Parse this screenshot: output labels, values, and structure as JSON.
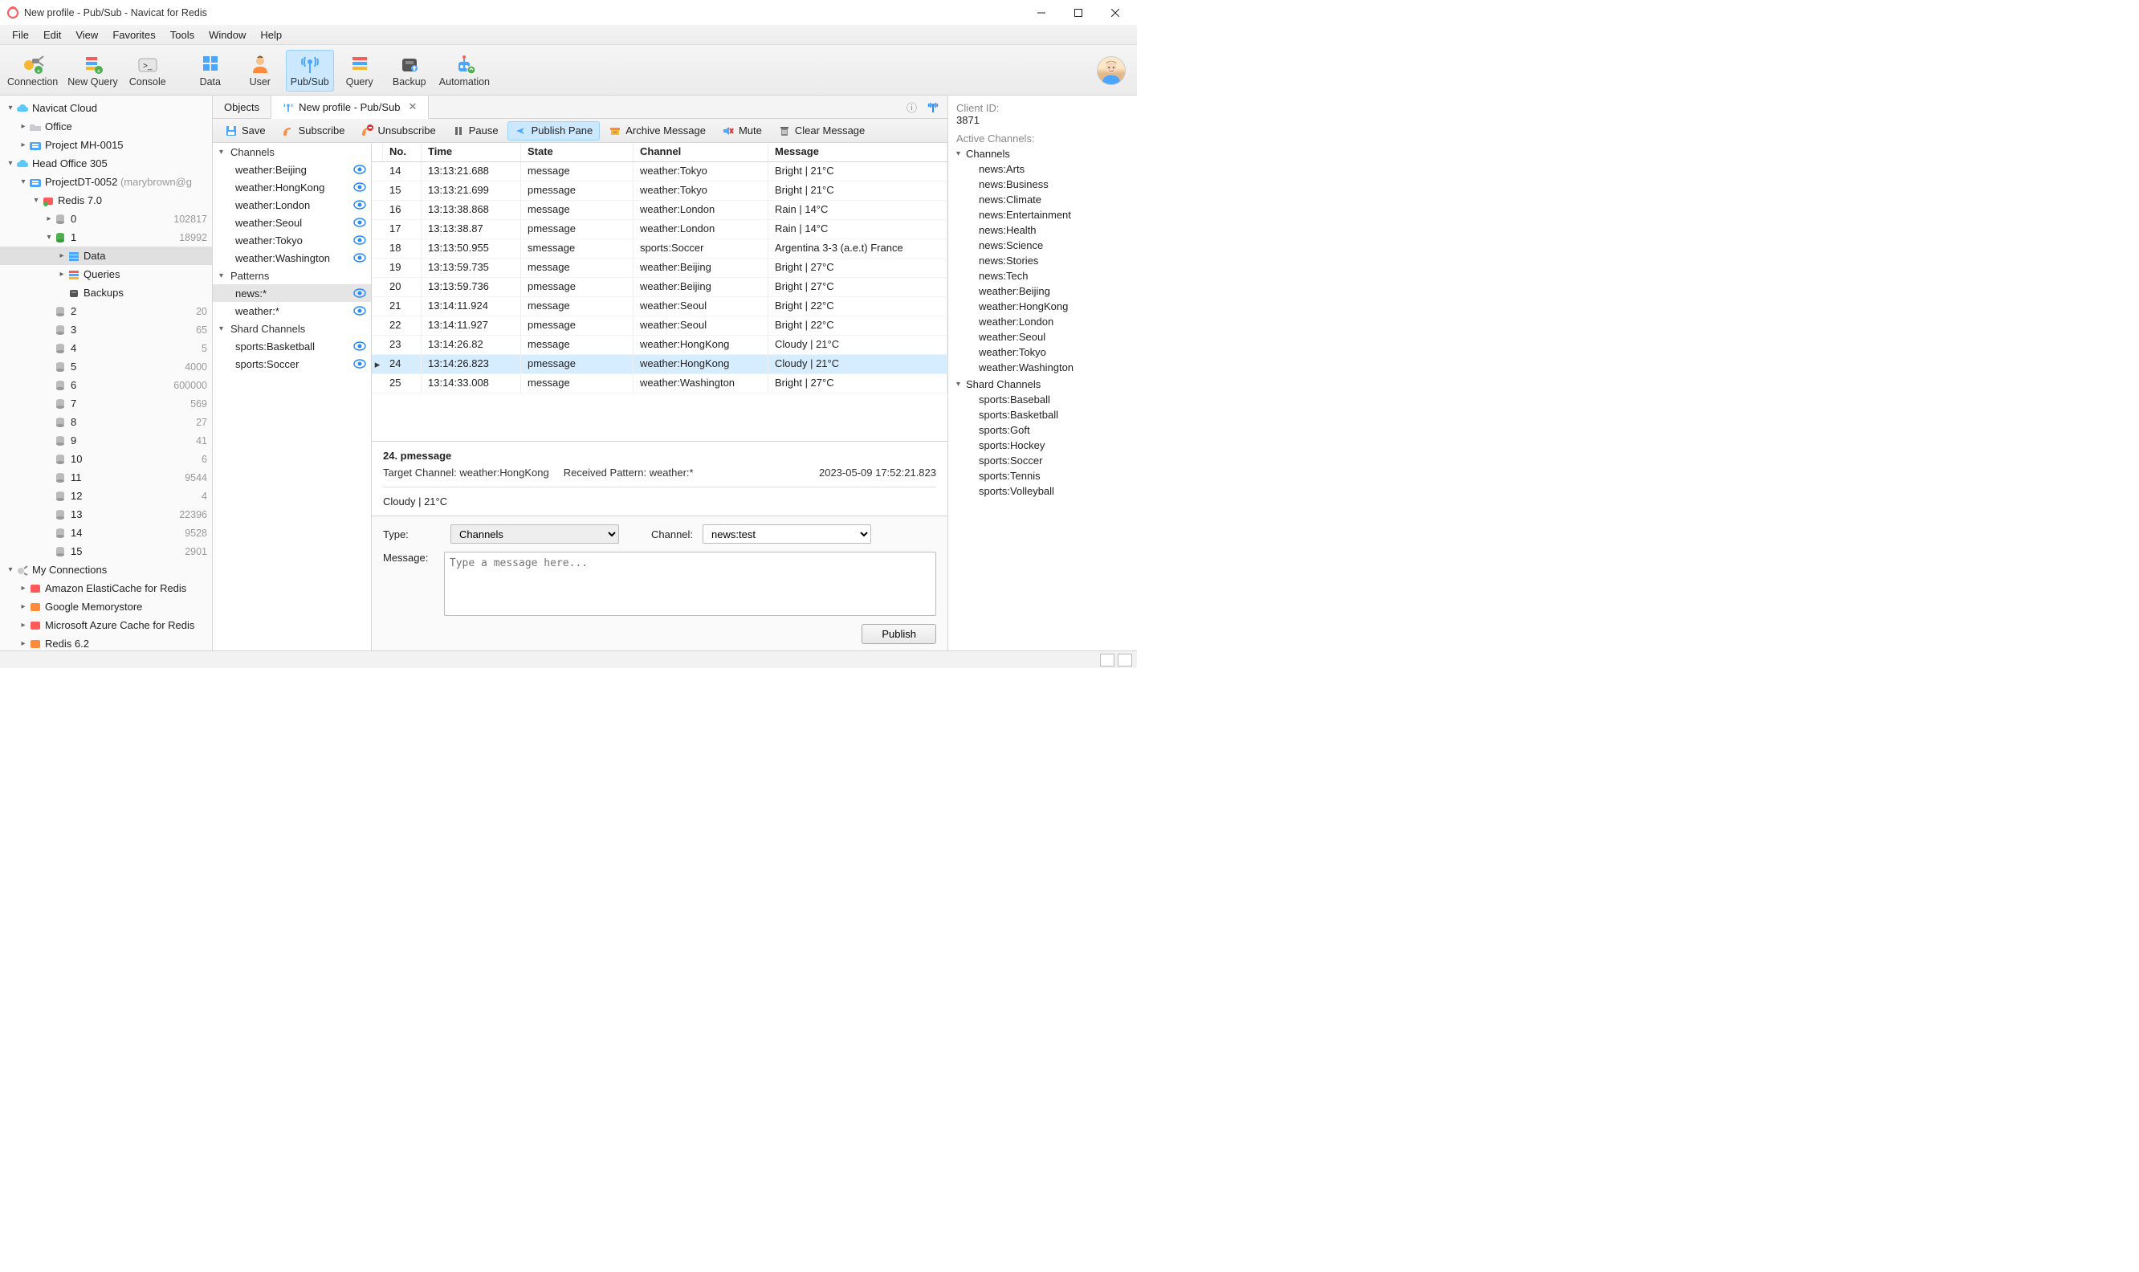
{
  "window": {
    "title": "New profile - Pub/Sub - Navicat for Redis"
  },
  "menu": [
    "File",
    "Edit",
    "View",
    "Favorites",
    "Tools",
    "Window",
    "Help"
  ],
  "toolbar": [
    {
      "icon": "plug",
      "label": "Connection"
    },
    {
      "icon": "file-new",
      "label": "New Query"
    },
    {
      "icon": "console",
      "label": "Console"
    },
    {
      "spacer": true
    },
    {
      "icon": "data",
      "label": "Data"
    },
    {
      "icon": "user",
      "label": "User"
    },
    {
      "icon": "pubsub",
      "label": "Pub/Sub",
      "active": true
    },
    {
      "icon": "query",
      "label": "Query"
    },
    {
      "icon": "backup",
      "label": "Backup"
    },
    {
      "icon": "automation",
      "label": "Automation"
    }
  ],
  "left_tree": [
    {
      "depth": 0,
      "twisty": "down",
      "icon": "cloud",
      "label": "Navicat Cloud"
    },
    {
      "depth": 1,
      "twisty": "right",
      "icon": "folder",
      "label": "Office"
    },
    {
      "depth": 1,
      "twisty": "right",
      "icon": "folder-b",
      "label": "Project MH-0015"
    },
    {
      "depth": 0,
      "twisty": "down",
      "icon": "cloud",
      "label": "Head Office 305"
    },
    {
      "depth": 1,
      "twisty": "down",
      "icon": "folder-b",
      "label": "ProjectDT-0052",
      "trailing_dim": "(marybrown@g"
    },
    {
      "depth": 2,
      "twisty": "down",
      "icon": "redis",
      "label": "Redis 7.0"
    },
    {
      "depth": 3,
      "twisty": "right",
      "icon": "db",
      "label": "0",
      "count": "102817"
    },
    {
      "depth": 3,
      "twisty": "down",
      "icon": "db-green",
      "label": "1",
      "count": "18992"
    },
    {
      "depth": 4,
      "twisty": "right",
      "icon": "rows",
      "label": "Data",
      "selected": true
    },
    {
      "depth": 4,
      "twisty": "right",
      "icon": "query",
      "label": "Queries"
    },
    {
      "depth": 4,
      "twisty": "",
      "icon": "backup",
      "label": "Backups"
    },
    {
      "depth": 3,
      "twisty": "",
      "icon": "db",
      "label": "2",
      "count": "20"
    },
    {
      "depth": 3,
      "twisty": "",
      "icon": "db",
      "label": "3",
      "count": "65"
    },
    {
      "depth": 3,
      "twisty": "",
      "icon": "db",
      "label": "4",
      "count": "5"
    },
    {
      "depth": 3,
      "twisty": "",
      "icon": "db",
      "label": "5",
      "count": "4000"
    },
    {
      "depth": 3,
      "twisty": "",
      "icon": "db",
      "label": "6",
      "count": "600000"
    },
    {
      "depth": 3,
      "twisty": "",
      "icon": "db",
      "label": "7",
      "count": "569"
    },
    {
      "depth": 3,
      "twisty": "",
      "icon": "db",
      "label": "8",
      "count": "27"
    },
    {
      "depth": 3,
      "twisty": "",
      "icon": "db",
      "label": "9",
      "count": "41"
    },
    {
      "depth": 3,
      "twisty": "",
      "icon": "db",
      "label": "10",
      "count": "6"
    },
    {
      "depth": 3,
      "twisty": "",
      "icon": "db",
      "label": "11",
      "count": "9544"
    },
    {
      "depth": 3,
      "twisty": "",
      "icon": "db",
      "label": "12",
      "count": "4"
    },
    {
      "depth": 3,
      "twisty": "",
      "icon": "db",
      "label": "13",
      "count": "22396"
    },
    {
      "depth": 3,
      "twisty": "",
      "icon": "db",
      "label": "14",
      "count": "9528"
    },
    {
      "depth": 3,
      "twisty": "",
      "icon": "db",
      "label": "15",
      "count": "2901"
    },
    {
      "depth": 0,
      "twisty": "down",
      "icon": "plug",
      "label": "My Connections"
    },
    {
      "depth": 1,
      "twisty": "right",
      "icon": "svc-r",
      "label": "Amazon ElastiCache for Redis"
    },
    {
      "depth": 1,
      "twisty": "right",
      "icon": "svc-o",
      "label": "Google Memorystore"
    },
    {
      "depth": 1,
      "twisty": "right",
      "icon": "svc-r",
      "label": "Microsoft Azure Cache for Redis"
    },
    {
      "depth": 1,
      "twisty": "right",
      "icon": "svc-o",
      "label": "Redis 6.2"
    }
  ],
  "tabs": [
    {
      "label": "Objects"
    },
    {
      "label": "New profile - Pub/Sub",
      "icon": "antenna",
      "active": true,
      "closable": true
    }
  ],
  "actionbar": [
    {
      "icon": "save",
      "label": "Save"
    },
    {
      "icon": "subscribe",
      "label": "Subscribe"
    },
    {
      "icon": "unsubscribe",
      "label": "Unsubscribe"
    },
    {
      "icon": "pause",
      "label": "Pause"
    },
    {
      "icon": "publish",
      "label": "Publish Pane",
      "pressed": true
    },
    {
      "icon": "archive",
      "label": "Archive Message"
    },
    {
      "icon": "mute",
      "label": "Mute"
    },
    {
      "icon": "clear",
      "label": "Clear Message"
    }
  ],
  "channels_groups": [
    {
      "title": "Channels",
      "items": [
        {
          "name": "weather:Beijing"
        },
        {
          "name": "weather:HongKong"
        },
        {
          "name": "weather:London"
        },
        {
          "name": "weather:Seoul"
        },
        {
          "name": "weather:Tokyo"
        },
        {
          "name": "weather:Washington"
        }
      ]
    },
    {
      "title": "Patterns",
      "items": [
        {
          "name": "news:*",
          "selected": true
        },
        {
          "name": "weather:*"
        }
      ]
    },
    {
      "title": "Shard Channels",
      "items": [
        {
          "name": "sports:Basketball"
        },
        {
          "name": "sports:Soccer"
        }
      ]
    }
  ],
  "table": {
    "headers": [
      "No.",
      "Time",
      "State",
      "Channel",
      "Message"
    ],
    "rows": [
      {
        "no": "14",
        "time": "13:13:21.688",
        "state": "message",
        "channel": "weather:Tokyo",
        "msg": "Bright | 21°C"
      },
      {
        "no": "15",
        "time": "13:13:21.699",
        "state": "pmessage",
        "channel": "weather:Tokyo",
        "msg": "Bright | 21°C"
      },
      {
        "no": "16",
        "time": "13:13:38.868",
        "state": "message",
        "channel": "weather:London",
        "msg": "Rain | 14°C"
      },
      {
        "no": "17",
        "time": "13:13:38.87",
        "state": "pmessage",
        "channel": "weather:London",
        "msg": "Rain | 14°C"
      },
      {
        "no": "18",
        "time": "13:13:50.955",
        "state": "smessage",
        "channel": "sports:Soccer",
        "msg": "Argentina 3-3 (a.e.t) France"
      },
      {
        "no": "19",
        "time": "13:13:59.735",
        "state": "message",
        "channel": "weather:Beijing",
        "msg": "Bright | 27°C"
      },
      {
        "no": "20",
        "time": "13:13:59.736",
        "state": "pmessage",
        "channel": "weather:Beijing",
        "msg": "Bright | 27°C"
      },
      {
        "no": "21",
        "time": "13:14:11.924",
        "state": "message",
        "channel": "weather:Seoul",
        "msg": "Bright | 22°C"
      },
      {
        "no": "22",
        "time": "13:14:11.927",
        "state": "pmessage",
        "channel": "weather:Seoul",
        "msg": "Bright | 22°C"
      },
      {
        "no": "23",
        "time": "13:14:26.82",
        "state": "message",
        "channel": "weather:HongKong",
        "msg": "Cloudy | 21°C"
      },
      {
        "no": "24",
        "time": "13:14:26.823",
        "state": "pmessage",
        "channel": "weather:HongKong",
        "msg": "Cloudy | 21°C",
        "selected": true
      },
      {
        "no": "25",
        "time": "13:14:33.008",
        "state": "message",
        "channel": "weather:Washington",
        "msg": "Bright | 27°C"
      }
    ]
  },
  "detail": {
    "title": "24. pmessage",
    "target_label": "Target Channel:",
    "target_value": "weather:HongKong",
    "pattern_label": "Received Pattern:",
    "pattern_value": "weather:*",
    "timestamp": "2023-05-09 17:52:21.823",
    "body": "Cloudy | 21°C"
  },
  "publish": {
    "type_label": "Type:",
    "type_value": "Channels",
    "channel_label": "Channel:",
    "channel_value": "news:test",
    "message_label": "Message:",
    "placeholder": "Type a message here...",
    "button": "Publish"
  },
  "right": {
    "client_id_label": "Client ID:",
    "client_id_value": "3871",
    "active_label": "Active Channels:",
    "sections": [
      {
        "title": "Channels",
        "items": [
          "news:Arts",
          "news:Business",
          "news:Climate",
          "news:Entertainment",
          "news:Health",
          "news:Science",
          "news:Stories",
          "news:Tech",
          "weather:Beijing",
          "weather:HongKong",
          "weather:London",
          "weather:Seoul",
          "weather:Tokyo",
          "weather:Washington"
        ]
      },
      {
        "title": "Shard Channels",
        "items": [
          "sports:Baseball",
          "sports:Basketball",
          "sports:Goft",
          "sports:Hockey",
          "sports:Soccer",
          "sports:Tennis",
          "sports:Volleyball"
        ]
      }
    ]
  }
}
